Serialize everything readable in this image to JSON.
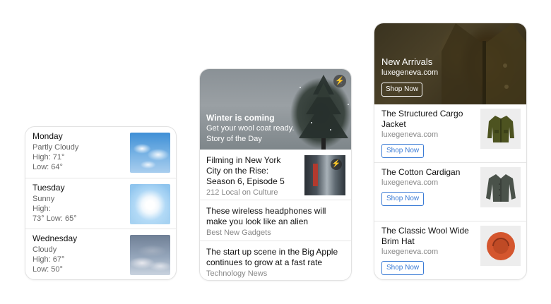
{
  "weather": {
    "days": [
      {
        "day": "Monday",
        "lines": [
          "Partly Cloudy",
          "High: 71°",
          "Low: 64°"
        ],
        "image": "partly-cloudy-sky"
      },
      {
        "day": "Tuesday",
        "lines": [
          "Sunny",
          "High:",
          "73° Low: 65°"
        ],
        "image": "sunny-sky"
      },
      {
        "day": "Wednesday",
        "lines": [
          "Cloudy",
          "High: 67°",
          "Low: 50°"
        ],
        "image": "cloudy-sky"
      }
    ]
  },
  "news": {
    "hero": {
      "title": "Winter is coming",
      "subtitle": "Get your wool coat ready.",
      "label": "Story of the Day",
      "badge_icon": "flash-icon"
    },
    "items": [
      {
        "title": "Filming in New York City on the Rise: Season 6, Episode 5",
        "source": "212 Local on Culture"
      },
      {
        "title": "These wireless headphones will make you look like an alien",
        "source": "Best New Gadgets"
      },
      {
        "title": "The start up scene in the Big Apple continues to grow at a fast rate",
        "source": "Technology News"
      }
    ]
  },
  "shop": {
    "hero": {
      "title": "New Arrivals",
      "domain": "luxegeneva.com",
      "button": "Shop Now"
    },
    "products": [
      {
        "title": "The Structured Cargo Jacket",
        "domain": "luxegeneva.com",
        "button": "Shop Now",
        "image": "olive-jacket"
      },
      {
        "title": "The Cotton Cardigan",
        "domain": "luxegeneva.com",
        "button": "Shop Now",
        "image": "grey-cardigan"
      },
      {
        "title": "The Classic Wool Wide Brim Hat",
        "domain": "luxegeneva.com",
        "button": "Shop Now",
        "image": "orange-hat"
      }
    ]
  },
  "colors": {
    "accent": "#3a7bd5",
    "divider": "#e6e6e6",
    "muted": "#888888"
  }
}
